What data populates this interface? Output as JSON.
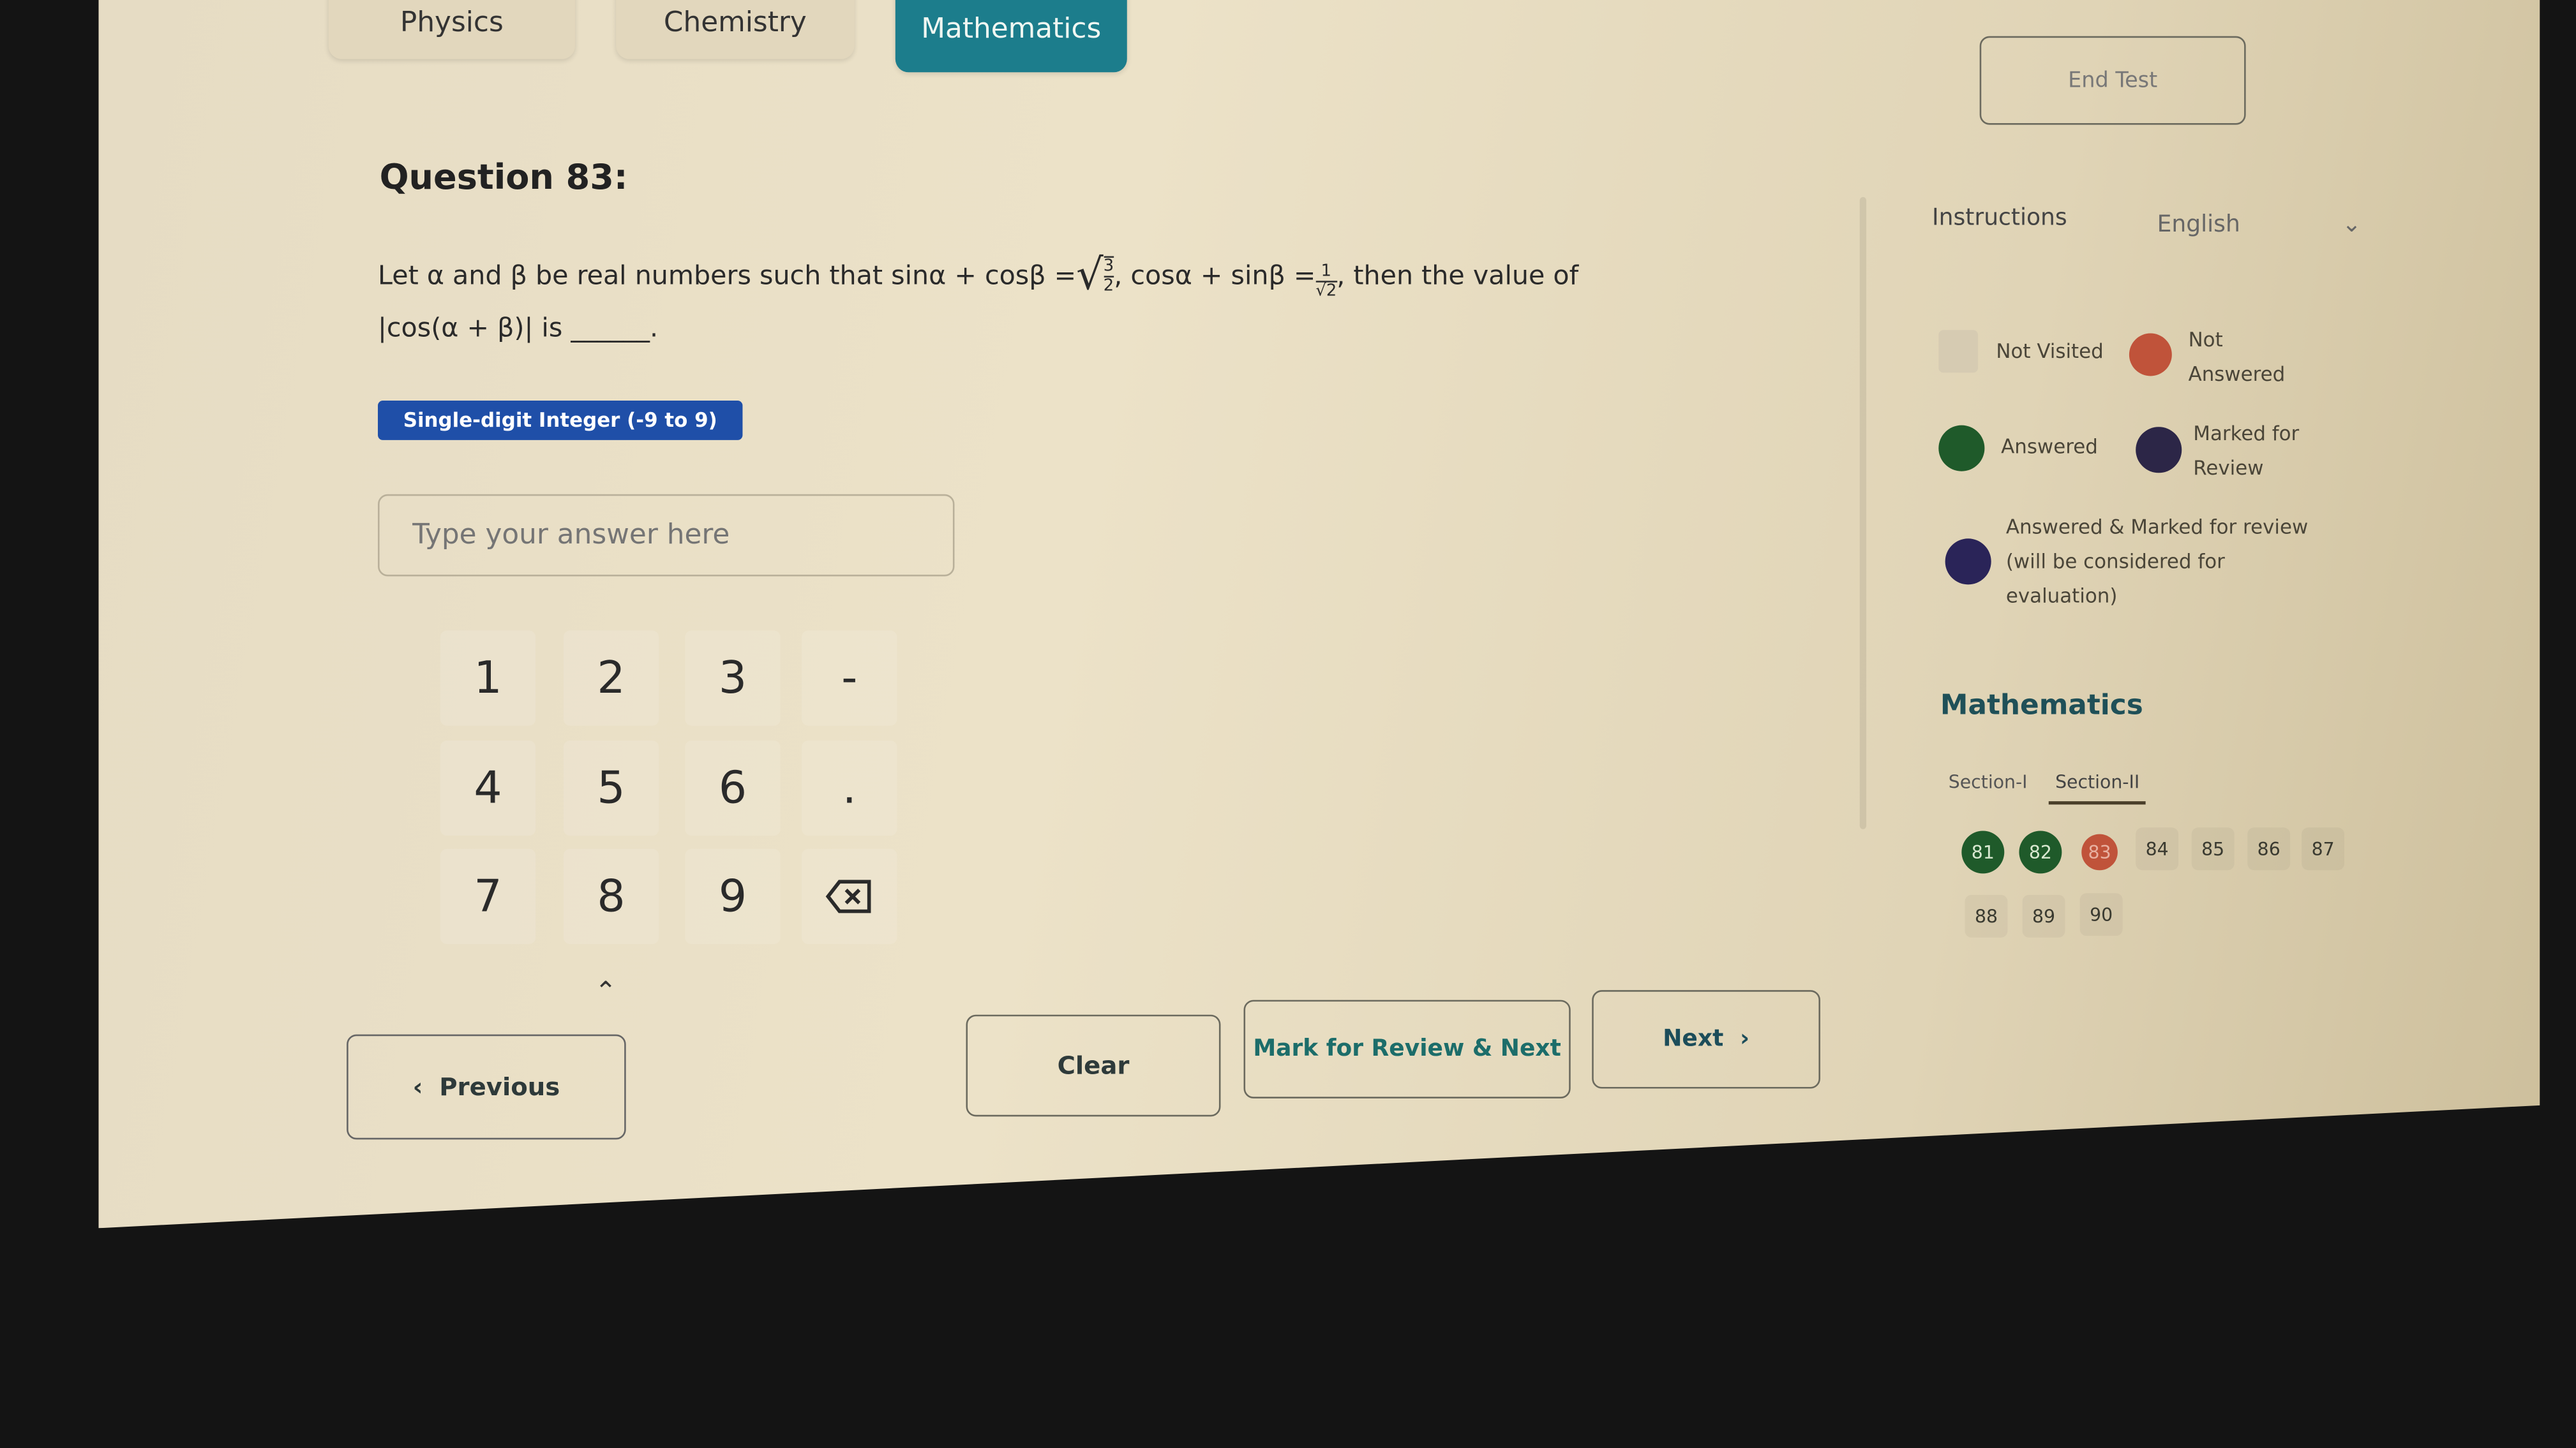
{
  "tabs": [
    {
      "label": "Physics",
      "active": false
    },
    {
      "label": "Chemistry",
      "active": false
    },
    {
      "label": "Mathematics",
      "active": true
    }
  ],
  "end_test_label": "End Test",
  "question": {
    "title": "Question 83:",
    "line1a": "Let α and β be real numbers such that sinα + cosβ = ",
    "sqrt_num": "3",
    "sqrt_den": "2",
    "line1b": ", cosα + sinβ = ",
    "frac_num": "1",
    "frac_den": "√2",
    "line1c": ", then the value of",
    "line2": "|cos(α + β)| is ______.",
    "type_badge": "Single-digit Integer (-9 to 9)",
    "answer_placeholder": "Type your answer here",
    "answer_value": ""
  },
  "keypad": {
    "keys": [
      "1",
      "2",
      "3",
      "-",
      "4",
      "5",
      "6",
      ".",
      "7",
      "8",
      "9"
    ],
    "backspace_icon": "backspace-icon",
    "collapse_icon": "caret-up-icon"
  },
  "buttons": {
    "previous": "Previous",
    "clear": "Clear",
    "mark_review": "Mark for Review & Next",
    "next": "Next"
  },
  "sidebar": {
    "instructions": "Instructions",
    "language": "English",
    "legend": [
      {
        "label": "Not Visited",
        "color": "#d6cbb2"
      },
      {
        "label": "Not Answered",
        "color": "#c0533a"
      },
      {
        "label": "Answered",
        "color": "#1f5a2a"
      },
      {
        "label": "Marked for Review",
        "color": "#2c2647"
      },
      {
        "label": "Answered & Marked for review (will be considered for evaluation)",
        "color": "#2a2458"
      }
    ],
    "subject": "Mathematics",
    "sections": [
      {
        "label": "Section-I",
        "active": false
      },
      {
        "label": "Section-II",
        "active": true
      }
    ],
    "questions": [
      {
        "n": "81",
        "status": "answered"
      },
      {
        "n": "82",
        "status": "answered"
      },
      {
        "n": "83",
        "status": "not-answered"
      },
      {
        "n": "84",
        "status": "not-visited"
      },
      {
        "n": "85",
        "status": "not-visited"
      },
      {
        "n": "86",
        "status": "not-visited"
      },
      {
        "n": "87",
        "status": "not-visited"
      },
      {
        "n": "88",
        "status": "not-visited"
      },
      {
        "n": "89",
        "status": "not-visited"
      },
      {
        "n": "90",
        "status": "not-visited"
      }
    ]
  },
  "colors": {
    "accent": "#1c7d8c",
    "badge": "#1f4fa8",
    "answered": "#1f5a2a",
    "not_answered": "#c0533a"
  }
}
